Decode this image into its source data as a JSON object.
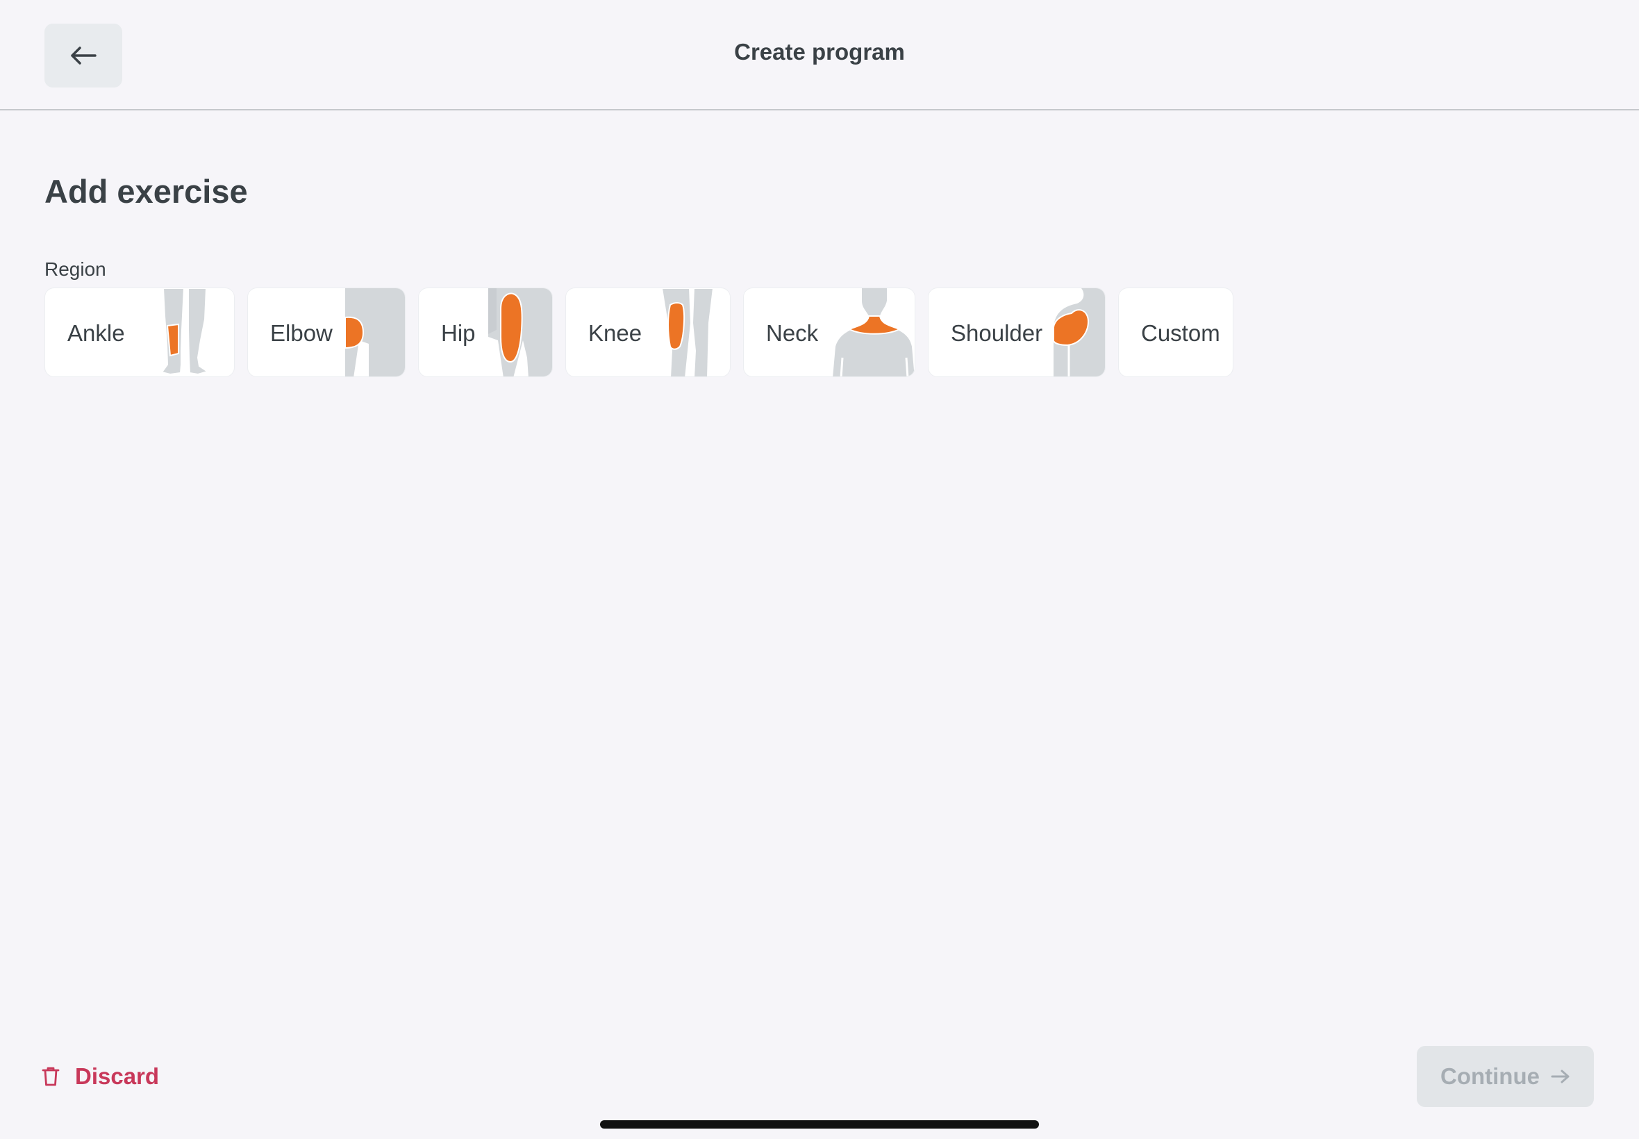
{
  "header": {
    "back_icon": "arrow-left-icon",
    "title": "Create program"
  },
  "main": {
    "section_title": "Add exercise",
    "region_label": "Region",
    "regions": [
      {
        "label": "Ankle"
      },
      {
        "label": "Elbow"
      },
      {
        "label": "Hip"
      },
      {
        "label": "Knee"
      },
      {
        "label": "Neck"
      },
      {
        "label": "Shoulder"
      },
      {
        "label": "Custom"
      }
    ]
  },
  "footer": {
    "discard_label": "Discard",
    "discard_icon": "trash-icon",
    "continue_label": "Continue",
    "continue_icon": "arrow-right-icon"
  },
  "colors": {
    "accent_orange": "#ec7425",
    "body_gray": "#d3d7da",
    "danger": "#c8385a",
    "background": "#f6f5f9"
  }
}
